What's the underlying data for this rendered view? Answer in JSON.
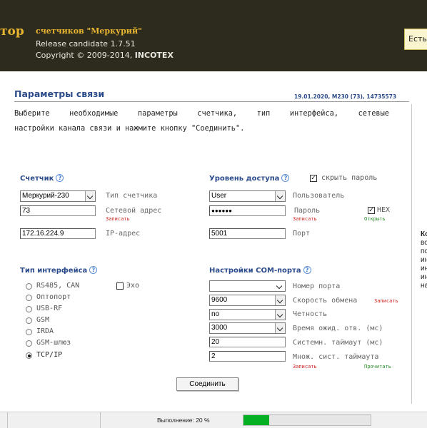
{
  "header": {
    "title_fragment": "тор",
    "product": "счетчиков \"Меркурий\"",
    "release": "Release candidate 1.7.51",
    "copyright_prefix": "Copyright © 2009-2014, ",
    "copyright_company": "INCOTEX",
    "side_tab": "Есть"
  },
  "page": {
    "title": "Параметры связи",
    "meta": "19.01.2020, М230 (73), 14735573",
    "desc_line1": "Выберите необходимые параметры счетчика, тип интерфейса, сетевые",
    "desc_line2": "настройки канала связи и нажмите кнопку \"Соединить\"."
  },
  "meter": {
    "heading": "Счетчик",
    "type_value": "Меркурий-230",
    "type_label": "Тип счетчика",
    "address_value": "73",
    "address_label": "Сетевой адрес",
    "address_write": "Записать",
    "ip_value": "172.16.224.9",
    "ip_label": "IP-адрес"
  },
  "access": {
    "heading": "Уровень доступа",
    "hide_password_label": "скрыть пароль",
    "hide_password_checked": true,
    "user_value": "User",
    "user_label": "Пользователь",
    "password_value": "●●●●●●",
    "password_label": "Пароль",
    "password_write": "Записать",
    "hex_label": "HEX",
    "hex_checked": true,
    "hex_open": "Открыть",
    "port_value": "5001",
    "port_label": "Порт"
  },
  "interface": {
    "heading": "Тип интерфейса",
    "echo_label": "Эхо",
    "echo_checked": false,
    "options": [
      "RS485, CAN",
      "Оптопорт",
      "USB-RF",
      "GSM",
      "IRDA",
      "GSM-шлюз",
      "TCP/IP"
    ],
    "selected": "TCP/IP"
  },
  "com": {
    "heading": "Настройки COM-порта",
    "port_value": "",
    "port_label": "Номер порта",
    "baud_value": "9600",
    "baud_label": "Скорость обмена",
    "baud_write": "Записать",
    "parity_value": "no",
    "parity_label": "Четность",
    "wait_value": "3000",
    "wait_label": "Время ожид. отв. (мс)",
    "timeout_value": "20",
    "timeout_label": "Системн. таймаут (мс)",
    "mult_value": "2",
    "mult_label": "Множ. сист. таймаута",
    "mult_write": "Записать",
    "mult_read": "Прочитать"
  },
  "connect_button": "Соединить",
  "side_panel": [
    "Ко",
    "во",
    "по",
    "ин",
    "ин",
    "ин",
    "на"
  ],
  "status": {
    "text": "Выполнение: 20 %",
    "progress": 0.2,
    "progress_color": "#06b025"
  },
  "colors": {
    "header_bg": "#2d2b1e",
    "header_accent": "#e8b530",
    "heading_blue": "#2c4b8a",
    "link_red": "#cc2222",
    "link_green": "#2a8a2a"
  }
}
